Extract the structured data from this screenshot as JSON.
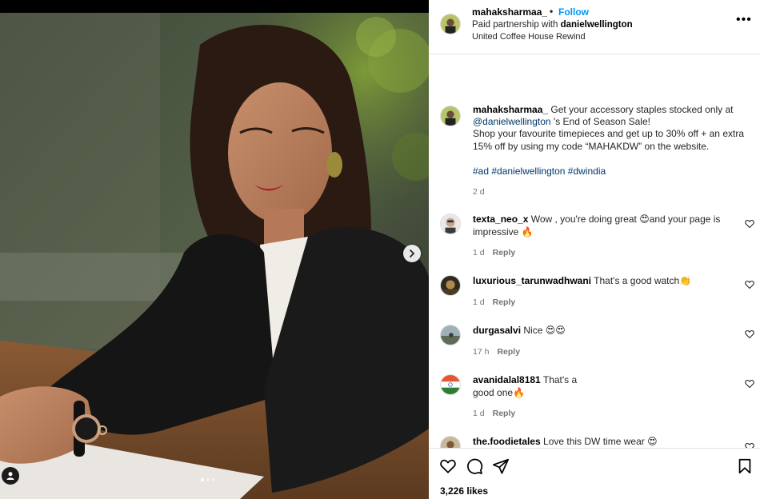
{
  "post": {
    "author": "mahaksharmaa_",
    "follow_label": "Follow",
    "separator": "•",
    "partnership_prefix": "Paid partnership with ",
    "partner": "danielwellington",
    "location": "United Coffee House Rewind",
    "more_icon": "more-horizontal-icon",
    "more_label": "•••"
  },
  "caption": {
    "username": "mahaksharmaa_",
    "text_1": " Get your accessory staples stocked only at ",
    "mention": "@danielwellington",
    "text_2": " 's End of Season Sale!",
    "text_3": "Shop your favourite timepieces and get up to 30% off + an extra 15% off by using my code “MAHAKDW” on the website.",
    "hashtags": [
      "#ad",
      "#danielwellington",
      "#dwindia"
    ],
    "time": "2 d"
  },
  "comments": [
    {
      "username": "texta_neo_x",
      "text": "Wow , you're doing great 😍and your page is impressive 🔥",
      "time": "1 d",
      "reply": "Reply"
    },
    {
      "username": "luxurious_tarunwadhwani",
      "text": "That's a good watch👏",
      "time": "1 d",
      "reply": "Reply"
    },
    {
      "username": "durgasalvi",
      "text": "Nice 😍😍",
      "time": "17 h",
      "reply": "Reply"
    },
    {
      "username": "avanidalal8181",
      "text": "That's a good one🔥",
      "time": "1 d",
      "reply": "Reply"
    },
    {
      "username": "the.foodietales",
      "text": "Love this DW time wear 😍",
      "time": "",
      "reply": ""
    }
  ],
  "actions": {
    "like_icon": "heart-icon",
    "comment_icon": "comment-icon",
    "share_icon": "share-icon",
    "save_icon": "bookmark-icon",
    "likes": "3,226 likes"
  },
  "carousel": {
    "count": 3,
    "current": 1
  },
  "colors": {
    "link": "#0095f6",
    "mention": "#00376b",
    "muted": "#737373",
    "border": "#e3e3e3"
  }
}
